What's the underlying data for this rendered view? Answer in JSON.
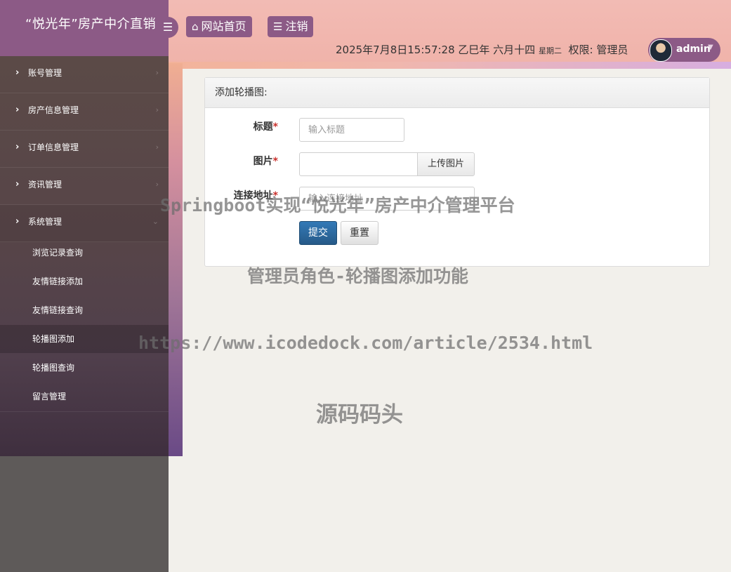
{
  "header": {
    "brand_title": "“悦光年”房产中介直销",
    "home_label": "网站首页",
    "logout_label": "注销",
    "datetime": "2025年7月8日15:57:28 乙巳年 六月十四",
    "weekday": "星期二",
    "permission": "权限: 管理员",
    "username": "admin"
  },
  "sidebar": {
    "items": [
      {
        "label": "账号管理"
      },
      {
        "label": "房产信息管理"
      },
      {
        "label": "订单信息管理"
      },
      {
        "label": "资讯管理"
      },
      {
        "label": "系统管理"
      }
    ],
    "sub_items": [
      {
        "label": "浏览记录查询"
      },
      {
        "label": "友情链接添加"
      },
      {
        "label": "友情链接查询"
      },
      {
        "label": "轮播图添加"
      },
      {
        "label": "轮播图查询"
      },
      {
        "label": "留言管理"
      }
    ]
  },
  "form": {
    "panel_title": "添加轮播图:",
    "title_label": "标题",
    "title_placeholder": "输入标题",
    "image_label": "图片",
    "image_value": "",
    "upload_label": "上传图片",
    "link_label": "连接地址",
    "link_placeholder": "输入连接地址",
    "required_mark": "*",
    "submit_label": "提交",
    "reset_label": "重置"
  },
  "watermark": {
    "line1": "Springboot实现“悦光年”房产中介管理平台",
    "line2": "管理员角色-轮播图添加功能",
    "line3": "https://www.icodedock.com/article/2534.html",
    "line4": "源码码头"
  },
  "icons": {
    "menu": "bars-icon",
    "home": "home-icon",
    "chevron_right": "chevron-right-icon",
    "chevron_down": "chevron-down-icon",
    "caret": "caret-down-icon"
  },
  "colors": {
    "brand": "#8c5a86",
    "header_bg": "#f2bbb4",
    "primary_button": "#337ab7",
    "required": "#c9302c"
  }
}
